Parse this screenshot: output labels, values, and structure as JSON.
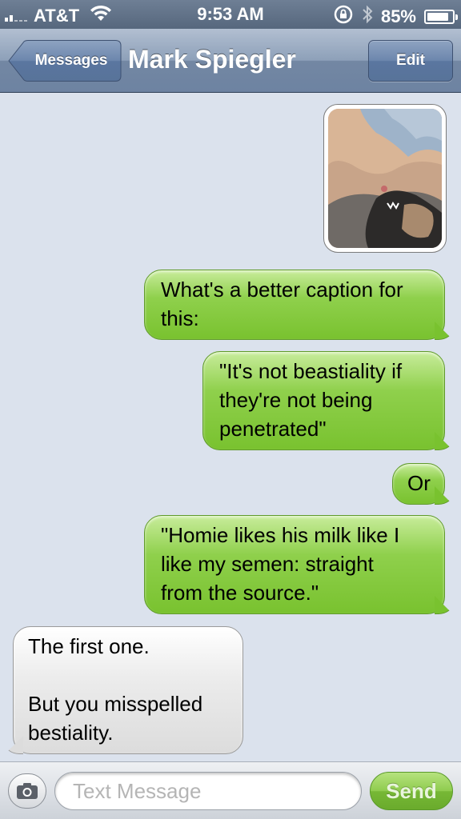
{
  "status_bar": {
    "carrier": "AT&T",
    "time": "9:53 AM",
    "battery_label": "85%",
    "battery_level": 0.85
  },
  "nav": {
    "back_label": "Messages",
    "title": "Mark Spiegler",
    "edit_label": "Edit"
  },
  "messages": [
    {
      "type": "image",
      "direction": "sent",
      "icon": "photo-attachment"
    },
    {
      "direction": "sent",
      "text": "What's a better caption for\nthis:"
    },
    {
      "direction": "sent",
      "text": "\"It's not beastiality if\nthey're not being\npenetrated\""
    },
    {
      "direction": "sent",
      "text": "Or"
    },
    {
      "direction": "sent",
      "text": "\"Homie likes his milk like I\nlike my semen: straight\nfrom the source.\""
    },
    {
      "direction": "received",
      "text": "The first one.\n\nBut you misspelled\nbestiality."
    }
  ],
  "input_bar": {
    "camera_icon": "camera-icon",
    "placeholder": "Text Message",
    "value": "",
    "send_label": "Send"
  },
  "colors": {
    "sent_bubble": "#79c22f",
    "received_bubble": "#dcdcdc",
    "background": "#dbe2ed",
    "nav_bar": "#6d83a2"
  }
}
